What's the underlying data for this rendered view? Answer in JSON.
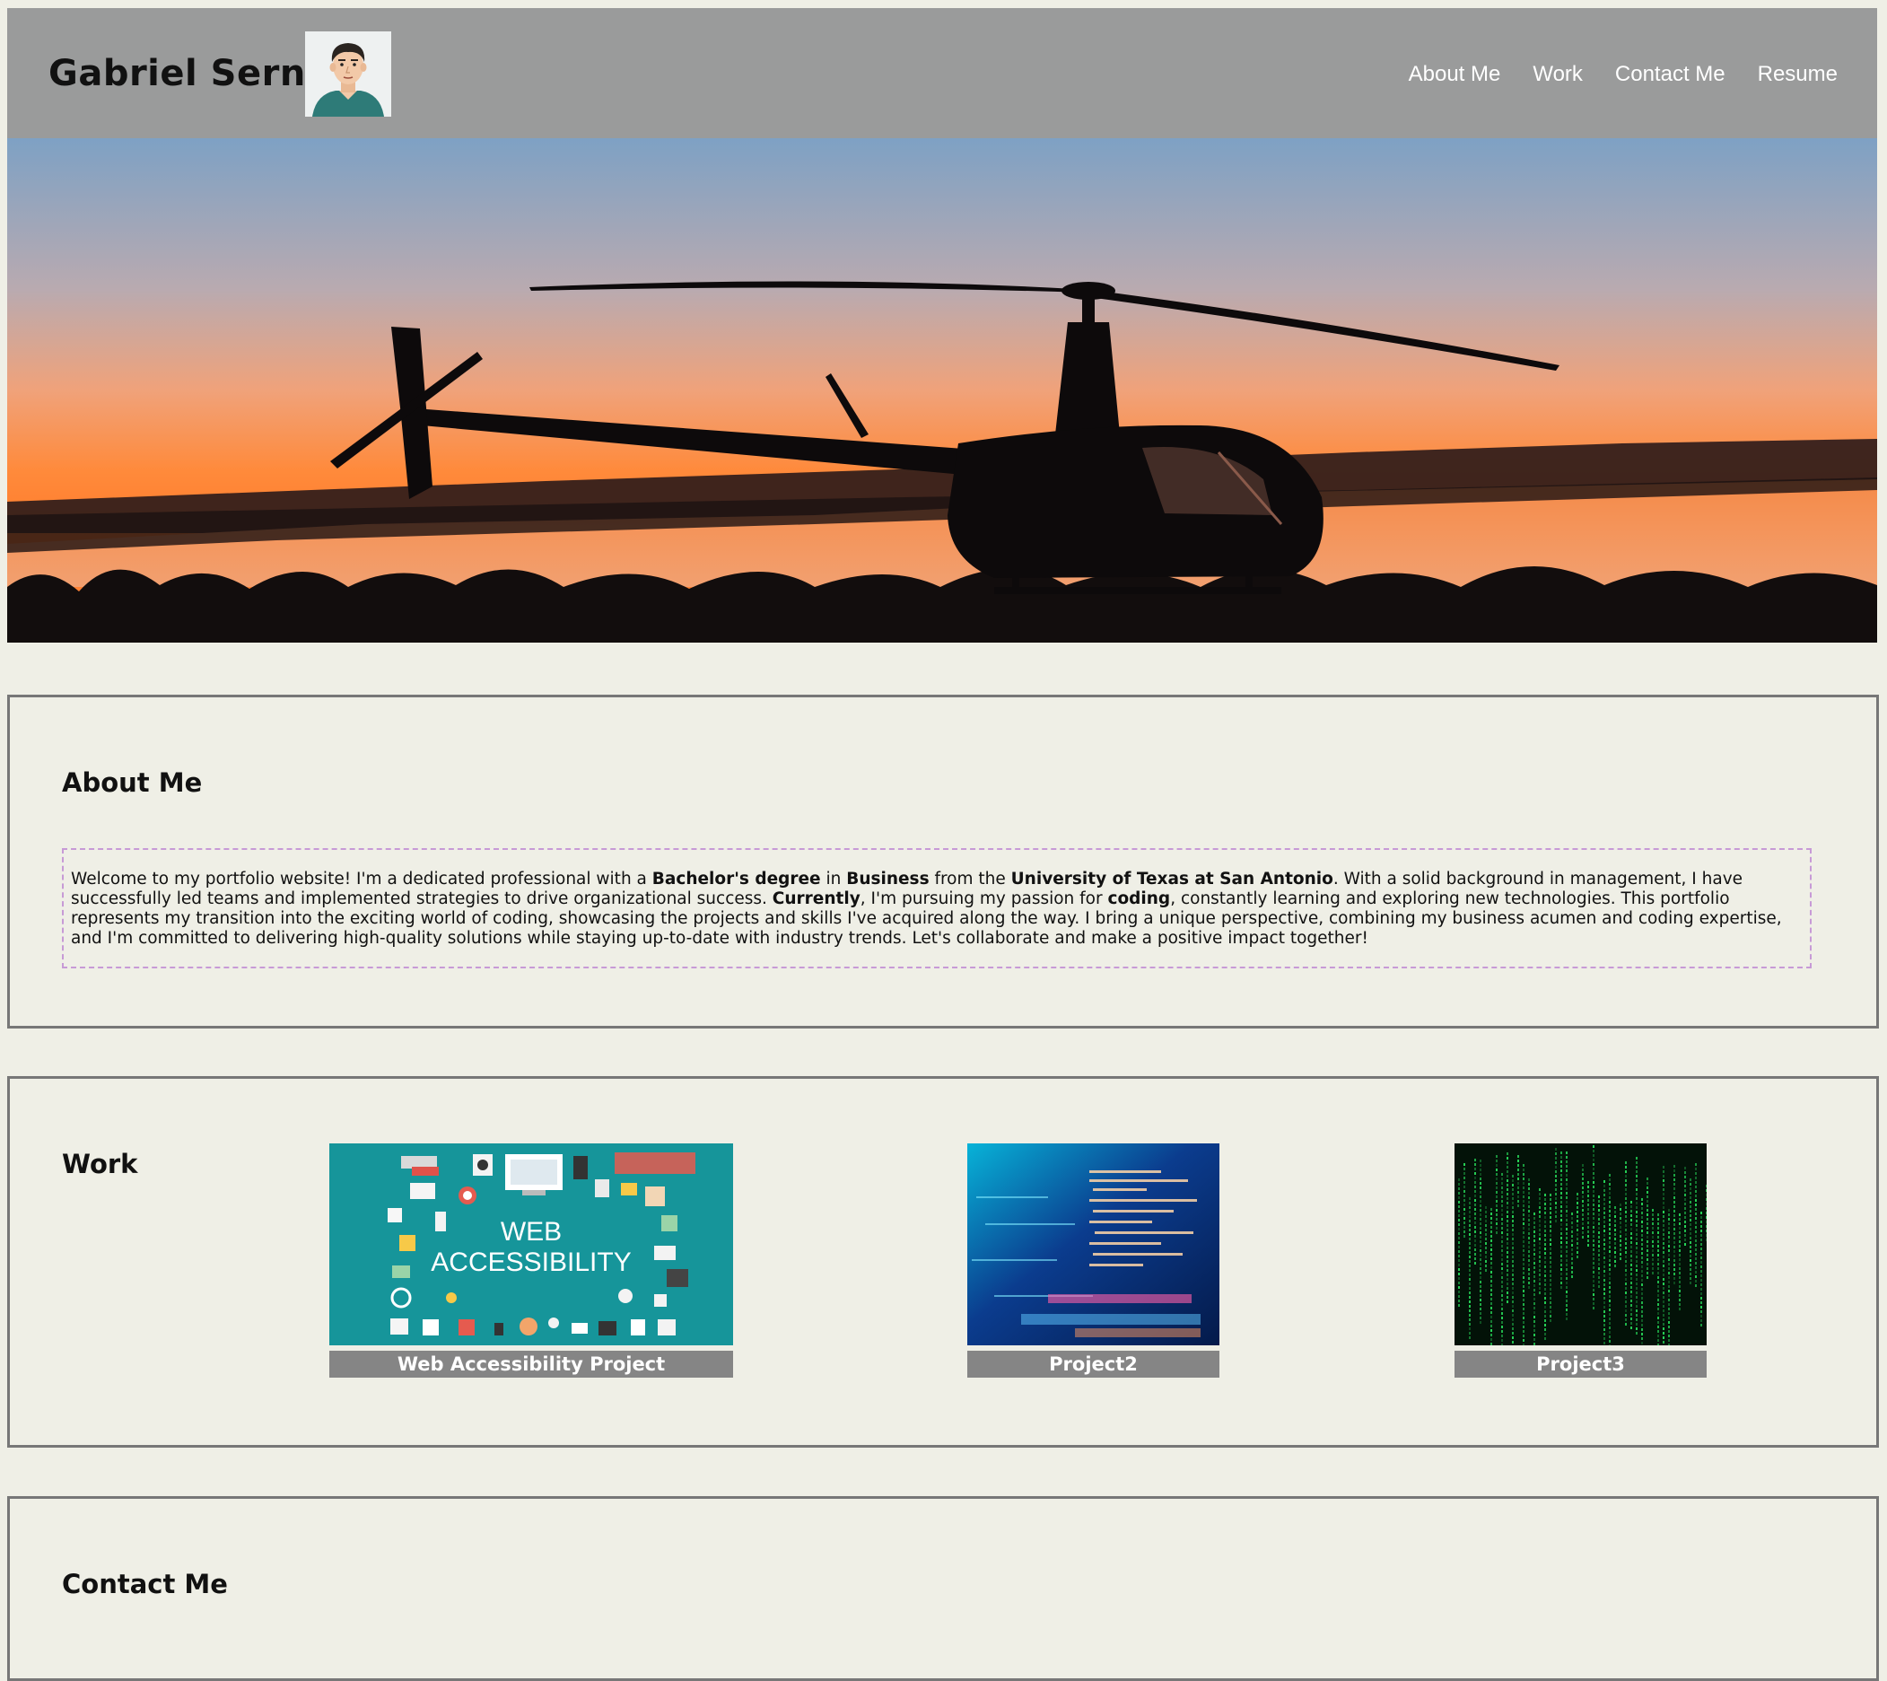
{
  "header": {
    "site_name": "Gabriel Serna",
    "nav": [
      "About Me",
      "Work",
      "Contact Me",
      "Resume"
    ]
  },
  "about": {
    "title": "About Me",
    "paragraph": [
      {
        "t": "Welcome to my portfolio website! I'm a dedicated professional with a ",
        "b": false
      },
      {
        "t": "Bachelor's degree",
        "b": true
      },
      {
        "t": " in ",
        "b": false
      },
      {
        "t": "Business",
        "b": true
      },
      {
        "t": " from the ",
        "b": false
      },
      {
        "t": "University of Texas at San Antonio",
        "b": true
      },
      {
        "t": ". With a solid background in management, I have successfully led teams and implemented strategies to drive organizational success. ",
        "b": false
      },
      {
        "t": "Currently",
        "b": true
      },
      {
        "t": ", I'm pursuing my passion for ",
        "b": false
      },
      {
        "t": "coding",
        "b": true
      },
      {
        "t": ", constantly learning and exploring new technologies. This portfolio represents my transition into the exciting world of coding, showcasing the projects and skills I've acquired along the way. I bring a unique perspective, combining my business acumen and coding expertise, and I'm committed to delivering high-quality solutions while staying up-to-date with industry trends. Let's collaborate and make a positive impact together!",
        "b": false
      }
    ]
  },
  "work": {
    "title": "Work",
    "projects": [
      {
        "caption": "Web Accessibility Project",
        "thumb_text": [
          "WEB",
          "ACCESSIBILITY"
        ]
      },
      {
        "caption": "Project2"
      },
      {
        "caption": "Project3"
      }
    ]
  },
  "contact": {
    "title": "Contact Me"
  },
  "colors": {
    "header_bg": "#9a9b9b",
    "page_bg": "#efefe6",
    "caption_bg": "#858585",
    "about_border": "#c79ad6",
    "accessibility_bg": "#16959a"
  },
  "icons": [
    "avatar-illustration",
    "helicopter-sunset-photo"
  ]
}
